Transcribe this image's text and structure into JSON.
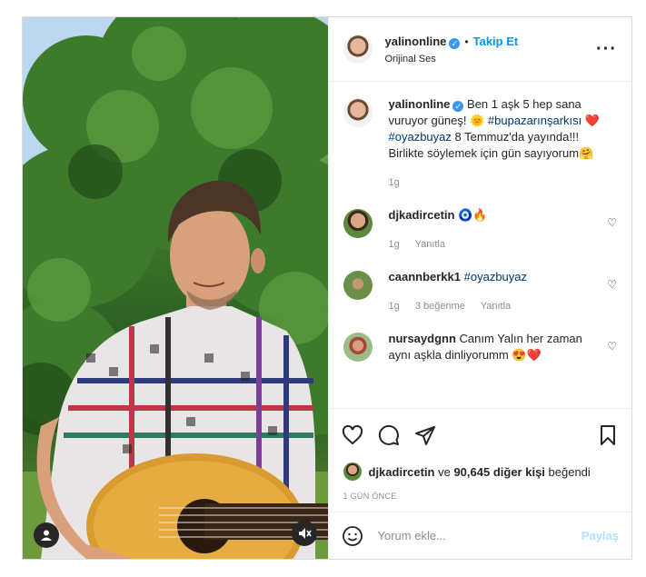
{
  "header": {
    "username": "yalinonline",
    "verified_mark": "✓",
    "separator": "•",
    "follow_label": "Takip Et",
    "audio_label": "Orijinal Ses",
    "more_icon": "more-icon"
  },
  "caption": {
    "username": "yalinonline",
    "text_part1": "Ben 1 aşk 5 hep sana vuruyor güneş! ",
    "sun_emoji": "🌞",
    "hashtag1": "#bupazarınşarkısı",
    "heart_emoji": "❤️",
    "hashtag2": "#oyazbuyaz",
    "text_part2": " 8 Temmuz'da yayında!!! Birlikte söylemek için gün sayıyorum",
    "hug_emoji": "🤗",
    "time": "1g"
  },
  "comments": [
    {
      "username": "djkadircetin",
      "text": "🧿🔥",
      "time": "1g",
      "likes": "",
      "reply": "Yanıtla"
    },
    {
      "username": "caannberkk1",
      "text": "#oyazbuyaz",
      "time": "1g",
      "likes": "3 beğenme",
      "reply": "Yanıtla"
    },
    {
      "username": "nursaydgnn",
      "text": "Canım Yalın her zaman aynı aşkla dinliyorumm 😍❤️",
      "time": "",
      "likes": "",
      "reply": ""
    }
  ],
  "likes": {
    "first_user": "djkadircetin",
    "connector": "ve",
    "others": "90,645 diğer kişi",
    "suffix": "beğendi"
  },
  "post_time": "1 GÜN ÖNCE",
  "add_comment": {
    "placeholder": "Yorum ekle...",
    "post_label": "Paylaş"
  },
  "colors": {
    "link_blue": "#0095f6",
    "verified_blue": "#3897f0",
    "hashtag": "#00376b",
    "muted_text": "#8e8e8e",
    "disabled_post": "#b2dffc"
  }
}
